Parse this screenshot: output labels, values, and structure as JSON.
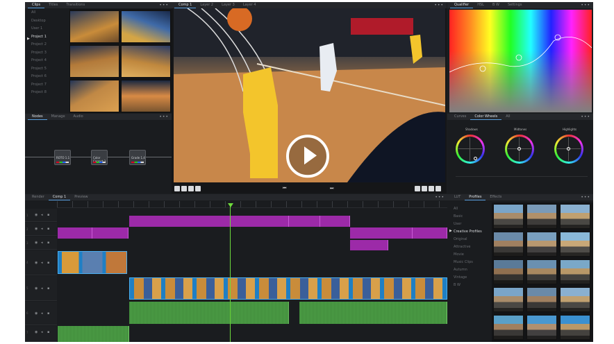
{
  "top_left_panel": {
    "tabs": [
      "Clips",
      "Titles",
      "Transitions"
    ],
    "bins": [
      "All",
      "Desktop",
      "User 1",
      "Project 1",
      "Project 2",
      "Project 3",
      "Project 4",
      "Project 5",
      "Project 6",
      "Project 7",
      "Project 8"
    ],
    "active_bin": "Project 1"
  },
  "viewer": {
    "tabs": [
      "Comp 1",
      "Layer 2",
      "Layer 3",
      "Layer 4"
    ]
  },
  "right_top_panel": {
    "tabs": [
      "Qualifier",
      "HSL",
      "B W",
      "Settings"
    ]
  },
  "nodes_panel": {
    "tabs": [
      "Nodes",
      "Manage",
      "Audio"
    ],
    "nodes": [
      {
        "label": "ROTO\n1.1"
      },
      {
        "label": "Color\nCorrect 1"
      },
      {
        "label": "Grade\n1.4"
      }
    ]
  },
  "color_panel": {
    "tabs": [
      "Curves",
      "Color Wheels",
      "All"
    ],
    "wheels": [
      "Shadows",
      "Midtones",
      "Highlights"
    ]
  },
  "timeline": {
    "tabs": [
      "Render",
      "Comp 1",
      "Preview"
    ],
    "track_numbers": [
      "1",
      "2",
      "3",
      "4",
      "5",
      "6",
      "7"
    ]
  },
  "profiles_panel": {
    "tabs": [
      "LUT",
      "Profiles",
      "Effects"
    ],
    "items": [
      "All",
      "Basic",
      "User",
      "Creative Profiles",
      "Original",
      "Attractive",
      "Movie",
      "Music Clips",
      "Autumn",
      "Vintage",
      "B W"
    ],
    "active": "Creative Profiles"
  },
  "dots": "•••",
  "colors": {
    "magenta_clip": "#9c2aa8",
    "video_clip": "#1f7fc4",
    "audio_clip": "#3f8a3a",
    "playhead": "#6fdc3c"
  }
}
